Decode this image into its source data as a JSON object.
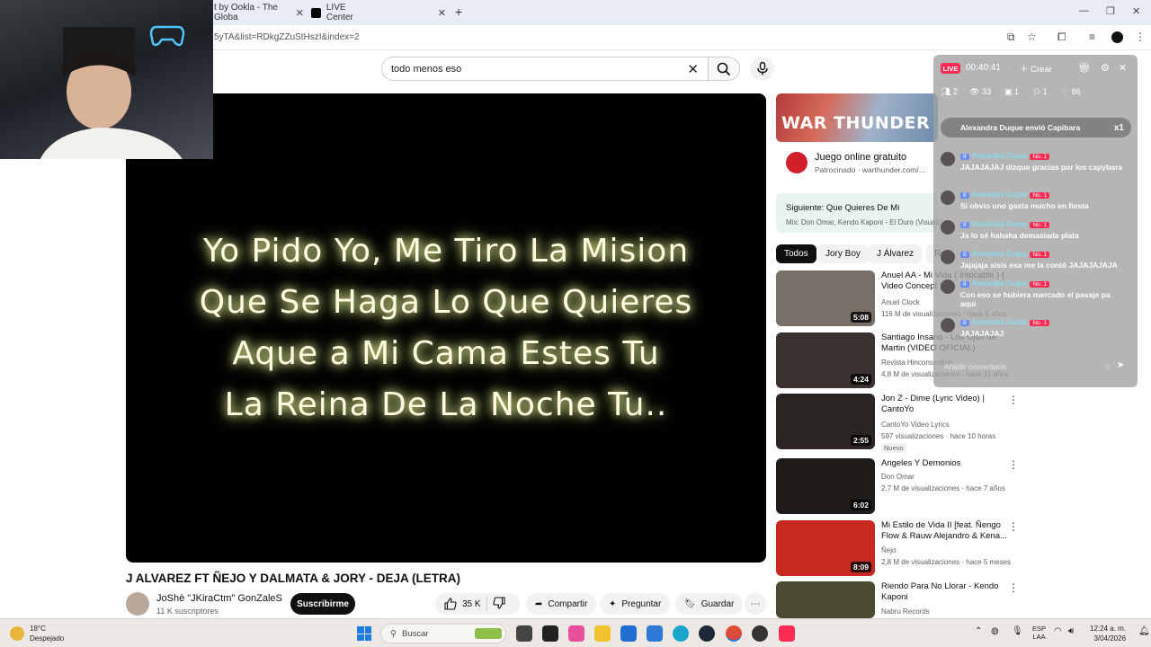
{
  "browser": {
    "tabs": [
      {
        "label": "t by Ookla - The Globa"
      },
      {
        "label": "LIVE Center"
      }
    ],
    "url": "5yTA&list=RDkgZZuStHszI&index=2"
  },
  "search": {
    "query": "todo menos eso"
  },
  "video": {
    "lyrics": [
      "Yo Pido Yo, Me Tiro La Mision",
      "Que Se Haga Lo Que Quieres",
      "Aque a Mi Cama Estes Tu",
      "La Reina De La Noche Tu.."
    ],
    "title": "J ALVAREZ FT ÑEJO Y DALMATA & JORY - DEJA (LETRA)",
    "channel": "JoShè \"JKiraCtm\" GonZaleS",
    "subscribers": "11 K suscriptores",
    "subscribe_label": "Suscribirme",
    "likes": "35 K",
    "share_label": "Compartir",
    "ask_label": "Preguntar",
    "save_label": "Guardar"
  },
  "ad": {
    "banner_text": "WAR THUNDER",
    "title": "Juego online gratuito",
    "sponsored": "Patrocinado · warthunder.com/..."
  },
  "next": {
    "label": "Siguiente: Que Quieres De Mi",
    "mix": "Mix: Don Omar, Kendo Kaponi - El Duro (Visualiz"
  },
  "chips": [
    "Todos",
    "Jory Boy",
    "J Álvarez",
    "Re"
  ],
  "recommendations": [
    {
      "title": "Anuel AA - Mi Vida ( Intocable ) ( Video Concept )",
      "channel": "Anuel Clock",
      "meta": "116 M de visualizaciones · hace 5 años",
      "duration": "5:08",
      "color": "#7a6e68"
    },
    {
      "title": "Santiago Insano - Los Ojos de Martin (VIDEO OFICIAL)",
      "channel": "Revista Hinconsentido",
      "meta": "4,8 M de visualizaciones · hace 11 años",
      "duration": "4:24",
      "color": "#3a3230"
    },
    {
      "title": "Jon Z - Dime (Lyric Video) | CantoYo",
      "channel": "CantoYo Video Lyrics",
      "meta": "597 visualizaciones · hace 10 horas",
      "duration": "2:55",
      "badge": "Nuevo",
      "color": "#2a2422"
    },
    {
      "title": "Angeles Y Demonios",
      "channel": "Don Omar",
      "meta": "2,7 M de visualizaciones · hace 7 años",
      "duration": "6:02",
      "color": "#1e1b19"
    },
    {
      "title": "Mi Estilo de Vida II [feat. Ñengo Flow & Rauw Alejandro & Kena...",
      "channel": "Ñejo",
      "meta": "2,8 M de visualizaciones · hace 5 meses",
      "duration": "8:09",
      "color": "#c8281e"
    },
    {
      "title": "Riendo Para No Llorar - Kendo Kaponi",
      "channel": "Nabru Records",
      "meta": "",
      "duration": "",
      "color": "#4a4a30"
    }
  ],
  "live": {
    "badge": "LIVE",
    "time": "00:40:41",
    "create_label": "Crear",
    "stats": [
      "2",
      "33",
      "1",
      "1",
      "86"
    ],
    "gift": {
      "text": "Alexandra Duque envió Capibara",
      "count": "x1"
    },
    "comments": [
      {
        "user": "Alexandra Duque",
        "text": "JAJAJAJAJ dizque gracias por los capybara"
      },
      {
        "user": "Alexandra Duque",
        "text": "Si obvio uno gasta mucho en fiesta"
      },
      {
        "user": "Alexandra Duque",
        "text": "Ja lo sé hahaha demasiada plata"
      },
      {
        "user": "Alexandra Duque",
        "text": "Jajajaja sisis esa me la contó JAJAJAJAJA"
      },
      {
        "user": "Alexandra Duque",
        "text": "Con eso se hubiera mercado el pasaje pa aqui"
      },
      {
        "user": "Alexandra Duque",
        "text": "JAJAJAJAJ"
      }
    ],
    "level": "8",
    "rank": "No. 1",
    "input_placeholder": "Añadir comentario"
  },
  "taskbar": {
    "temp": "18°C",
    "condition": "Despejado",
    "search_label": "Buscar",
    "lang": "ESP",
    "lang2": "LAA",
    "time": "12:24 a. m.",
    "date": "3/04/2026"
  }
}
